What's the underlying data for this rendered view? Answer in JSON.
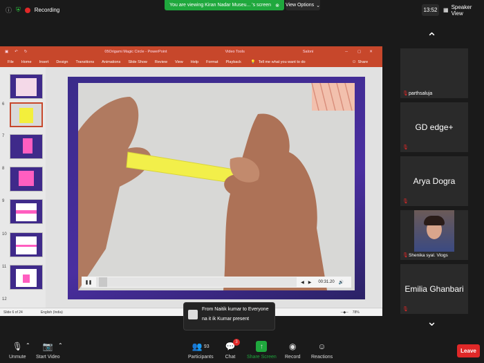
{
  "meeting": {
    "recording_label": "Recording",
    "viewing_banner": "You are viewing Kiran Nadar Museu... 's screen",
    "view_options_label": "View Options",
    "clock": "13:52",
    "speaker_view_label": "Speaker View"
  },
  "ppt": {
    "title": "05Origami Magic Circle  -  PowerPoint",
    "context_tab": "Video Tools",
    "user": "Saloni",
    "menu": [
      "File",
      "Home",
      "Insert",
      "Design",
      "Transitions",
      "Animations",
      "Slide Show",
      "Review",
      "View",
      "Help",
      "Format",
      "Playback"
    ],
    "tell_me": "Tell me what you want to do",
    "share": "Share",
    "thumb_numbers": [
      "6",
      "7",
      "8",
      "9",
      "10",
      "11",
      "12"
    ],
    "video_time": "00:31.20",
    "status_slide": "Slide 6 of 24",
    "status_lang": "English (India)",
    "zoom": "78%"
  },
  "participants": [
    {
      "name": "parthsaluja",
      "display": ""
    },
    {
      "name": "",
      "display": "GD edge+"
    },
    {
      "name": "",
      "display": "Arya Dogra"
    },
    {
      "name": "Shenika syal. Vlogs",
      "display": ""
    },
    {
      "name": "",
      "display": "Emilia Ghanbari"
    }
  ],
  "chat_popup": {
    "from": "From Naitik kumar to Everyone",
    "message": "na it ik Kumar present"
  },
  "toolbar": {
    "unmute": "Unmute",
    "start_video": "Start Video",
    "participants": "Participants",
    "participants_count": "93",
    "chat": "Chat",
    "chat_badge": "3",
    "share_screen": "Share Screen",
    "record": "Record",
    "reactions": "Reactions",
    "leave": "Leave"
  },
  "colors": {
    "ppt_accent": "#c7472b",
    "share_green": "#1fa83d",
    "leave_red": "#e02828"
  }
}
